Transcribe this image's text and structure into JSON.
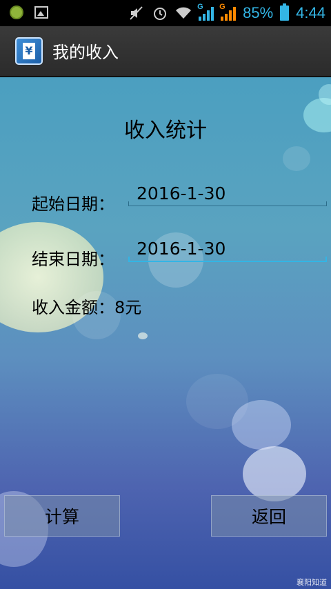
{
  "status_bar": {
    "battery_percent": "85%",
    "time": "4:44",
    "signal_1_label": "G",
    "signal_2_label": "G"
  },
  "action_bar": {
    "app_icon_symbol": "¥",
    "title": "我的收入"
  },
  "main": {
    "heading": "收入统计",
    "start_date_label": "起始日期：",
    "start_date_value": "2016-1-30",
    "end_date_label": "结束日期：",
    "end_date_value": "2016-1-30",
    "income_label": "收入金额：8元"
  },
  "buttons": {
    "calculate": "计算",
    "back": "返回"
  },
  "watermark": "襄阳知道"
}
